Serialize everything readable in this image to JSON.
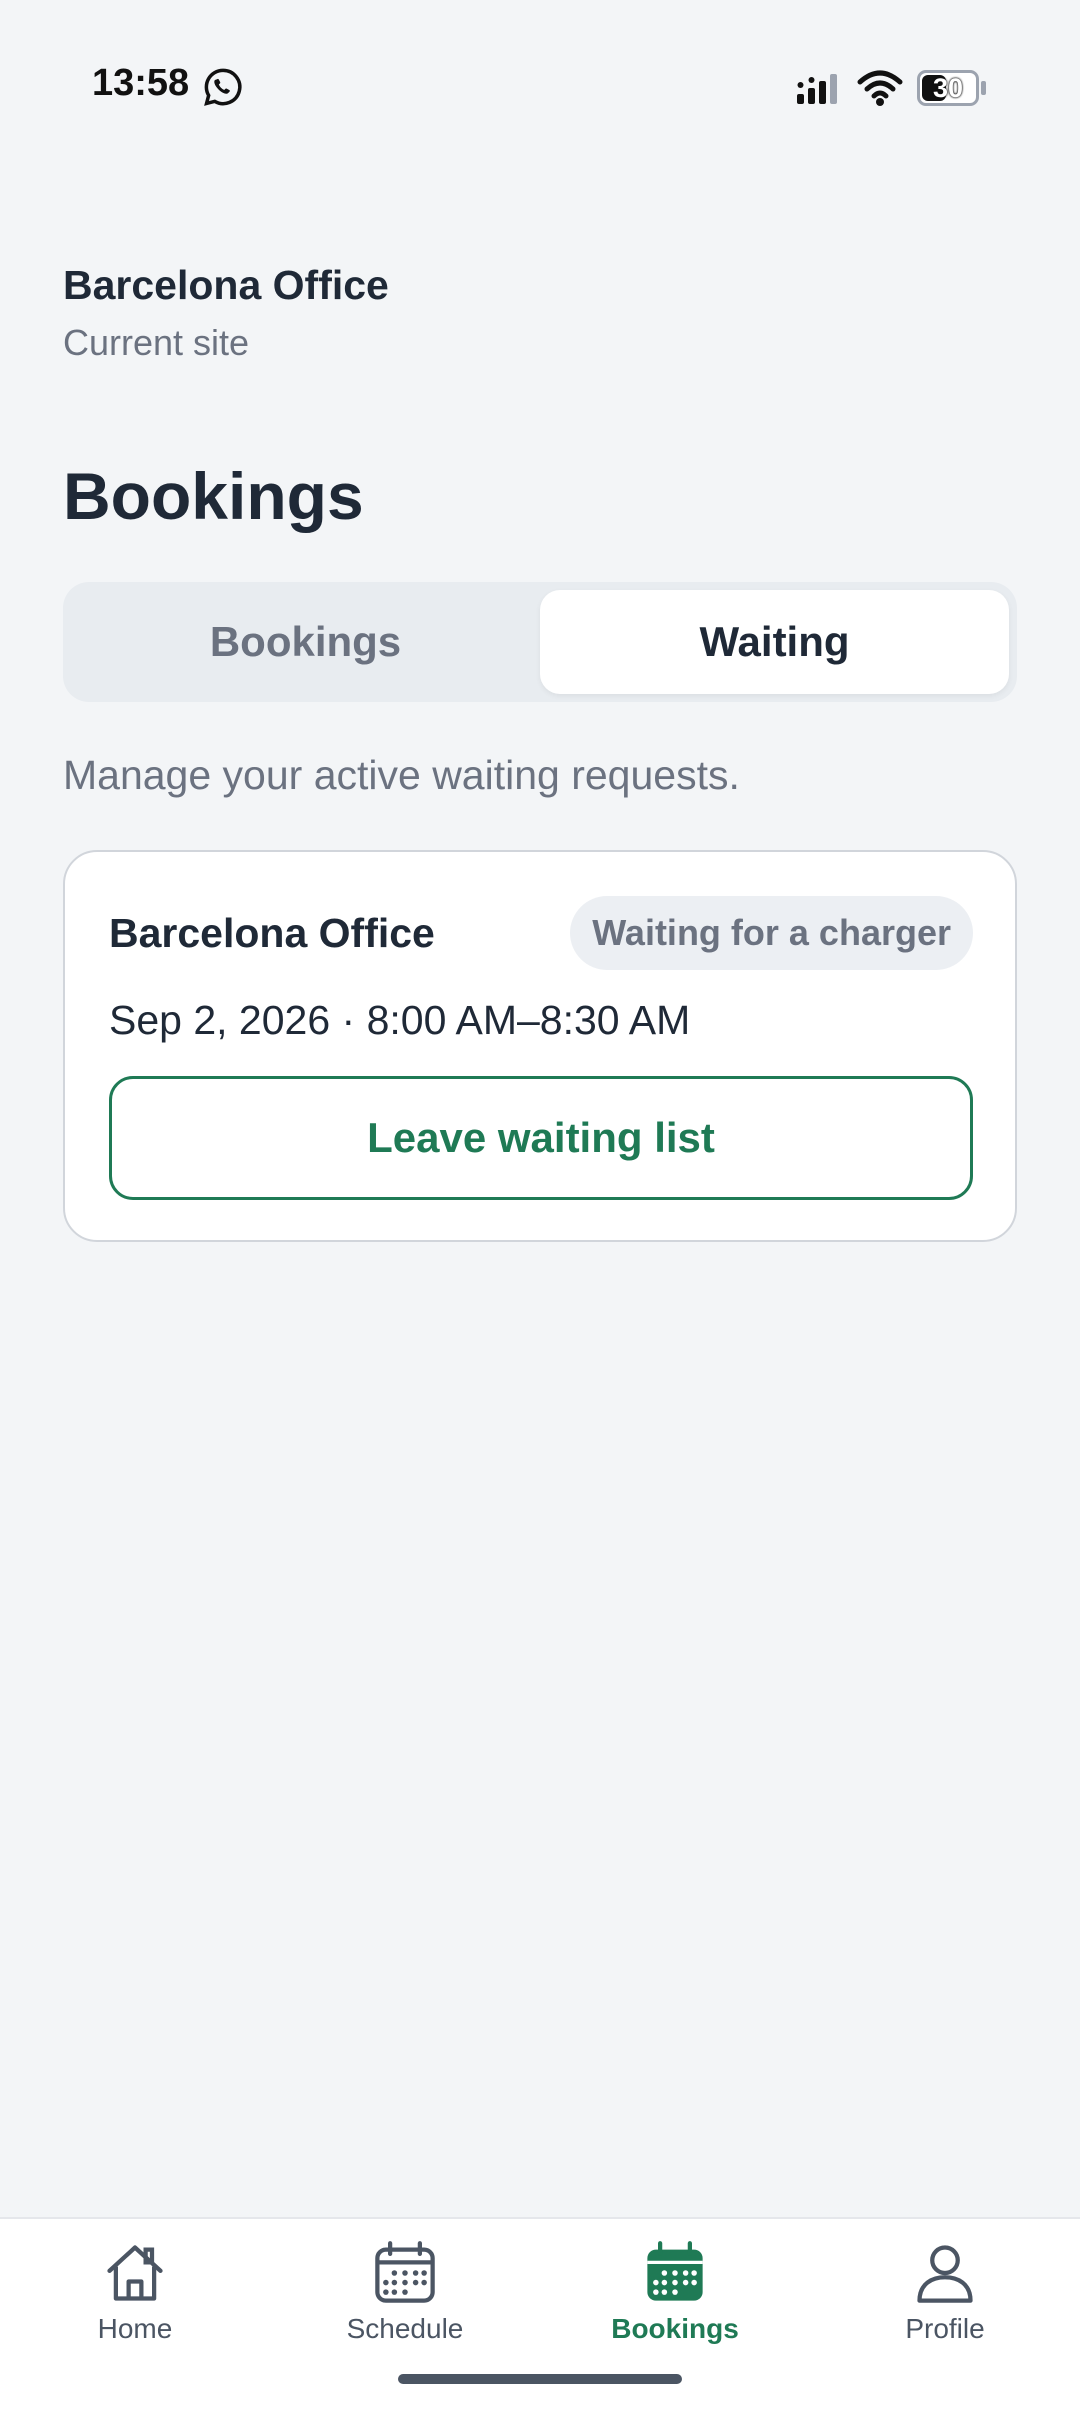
{
  "status_bar": {
    "time": "13:58",
    "battery": "30",
    "icons": [
      "whatsapp-icon",
      "signal-icon",
      "wifi-icon",
      "battery-icon"
    ]
  },
  "site": {
    "name": "Barcelona Office",
    "subtitle": "Current site"
  },
  "page": {
    "title": "Bookings",
    "tabs": [
      {
        "label": "Bookings",
        "active": false
      },
      {
        "label": "Waiting",
        "active": true
      }
    ],
    "helper": "Manage your active waiting requests."
  },
  "waiting_items": [
    {
      "site": "Barcelona Office",
      "status": "Waiting for a charger",
      "time": "Sep 2, 2026 · 8:00 AM–8:30 AM",
      "action": "Leave waiting list"
    }
  ],
  "nav": {
    "items": [
      {
        "label": "Home",
        "icon": "home-icon",
        "active": false
      },
      {
        "label": "Schedule",
        "icon": "calendar-icon",
        "active": false
      },
      {
        "label": "Bookings",
        "icon": "calendar-filled-icon",
        "active": true
      },
      {
        "label": "Profile",
        "icon": "user-icon",
        "active": false
      }
    ]
  },
  "colors": {
    "accent": "#1f7a55",
    "background": "#f3f5f7",
    "muted": "#6b7280"
  }
}
